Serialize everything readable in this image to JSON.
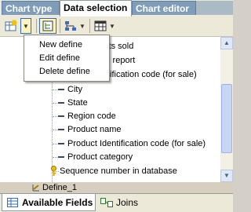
{
  "tabs": [
    "Chart type",
    "Data selection",
    "Chart editor"
  ],
  "toolbar": {
    "icons": [
      "add-define-icon",
      "chevron-down-icon",
      "tree-view-icon",
      "hierarchy-icon",
      "table-icon"
    ]
  },
  "menu": {
    "items": [
      "New define",
      "Edit define",
      "Delete define"
    ]
  },
  "tree": {
    "hidden_items": [
      "nits sold",
      "s report",
      "ification code (for sale)"
    ],
    "items": [
      "City",
      "State",
      "Region code",
      "Product name",
      "Product Identification code (for sale)",
      "Product category",
      "Sequence number in database"
    ]
  },
  "selected_define": "Define_1",
  "bottom_tabs": [
    "Available Fields",
    "Joins"
  ],
  "colors": {
    "tab_inactive": "#7f9db9",
    "menu_border": "#8a867a",
    "selection_bar": "#d6cfbf"
  }
}
